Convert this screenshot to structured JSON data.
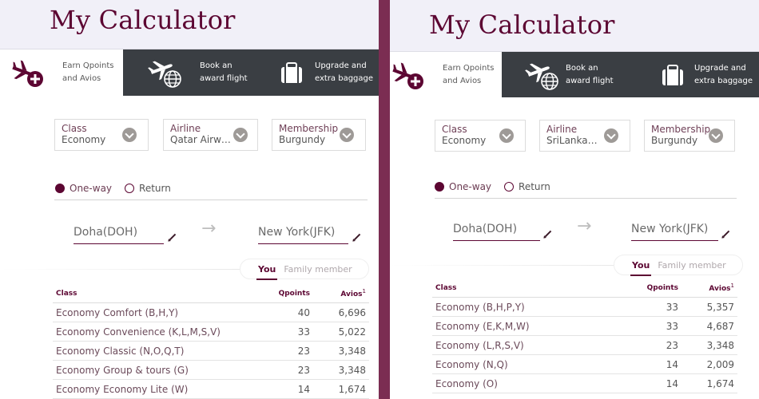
{
  "divider_color": "#7b2d52",
  "accent_color": "#5c0632",
  "tab_dark_color": "#3a3e43",
  "panels": [
    {
      "title": "My Calculator",
      "tabs": [
        {
          "label": "Earn Qpoints\nand Avios",
          "icon": "plane-plus-icon",
          "active": true
        },
        {
          "label": "Book an\naward flight",
          "icon": "plane-globe-icon",
          "active": false
        },
        {
          "label": "Upgrade and\nextra baggage",
          "icon": "suitcase-icon",
          "active": false
        }
      ],
      "selects": [
        {
          "label": "Class",
          "value": "Economy"
        },
        {
          "label": "Airline",
          "value": "Qatar Airways"
        },
        {
          "label": "Membership",
          "value": "Burgundy"
        }
      ],
      "trip_types": [
        {
          "label": "One-way",
          "checked": true
        },
        {
          "label": "Return",
          "checked": false
        }
      ],
      "origin": "Doha(DOH)",
      "destination": "New York(JFK)",
      "member_toggle": [
        {
          "label": "You",
          "active": true
        },
        {
          "label": "Family member",
          "active": false
        }
      ],
      "table": {
        "headers": {
          "class": "Class",
          "qpoints": "Qpoints",
          "avios": "Avios",
          "avios_note": "1"
        },
        "rows": [
          {
            "class": "Economy Comfort (B,H,Y)",
            "qpoints": "40",
            "avios": "6,696"
          },
          {
            "class": "Economy Convenience (K,L,M,S,V)",
            "qpoints": "33",
            "avios": "5,022"
          },
          {
            "class": "Economy Classic (N,O,Q,T)",
            "qpoints": "23",
            "avios": "3,348"
          },
          {
            "class": "Economy Group & tours (G)",
            "qpoints": "23",
            "avios": "3,348"
          },
          {
            "class": "Economy Economy Lite (W)",
            "qpoints": "14",
            "avios": "1,674"
          }
        ]
      }
    },
    {
      "title": "My Calculator",
      "tabs": [
        {
          "label": "Earn Qpoints\nand Avios",
          "icon": "plane-plus-icon",
          "active": true
        },
        {
          "label": "Book an\naward flight",
          "icon": "plane-globe-icon",
          "active": false
        },
        {
          "label": "Upgrade and\nextra baggage",
          "icon": "suitcase-icon",
          "active": false
        }
      ],
      "selects": [
        {
          "label": "Class",
          "value": "Economy"
        },
        {
          "label": "Airline",
          "value": "SriLankan Ai..."
        },
        {
          "label": "Membership",
          "value": "Burgundy"
        }
      ],
      "trip_types": [
        {
          "label": "One-way",
          "checked": true
        },
        {
          "label": "Return",
          "checked": false
        }
      ],
      "origin": "Doha(DOH)",
      "destination": "New York(JFK)",
      "member_toggle": [
        {
          "label": "You",
          "active": true
        },
        {
          "label": "Family member",
          "active": false
        }
      ],
      "table": {
        "headers": {
          "class": "Class",
          "qpoints": "Qpoints",
          "avios": "Avios",
          "avios_note": "1"
        },
        "rows": [
          {
            "class": "Economy (B,H,P,Y)",
            "qpoints": "33",
            "avios": "5,357"
          },
          {
            "class": "Economy (E,K,M,W)",
            "qpoints": "33",
            "avios": "4,687"
          },
          {
            "class": "Economy (L,R,S,V)",
            "qpoints": "23",
            "avios": "3,348"
          },
          {
            "class": "Economy (N,Q)",
            "qpoints": "14",
            "avios": "2,009"
          },
          {
            "class": "Economy (O)",
            "qpoints": "14",
            "avios": "1,674"
          }
        ]
      }
    }
  ]
}
